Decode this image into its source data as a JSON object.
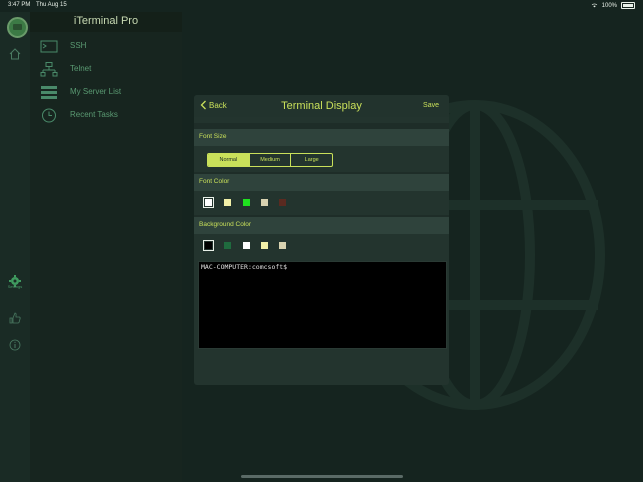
{
  "status_bar": {
    "time": "3:47 PM",
    "date": "Thu Aug 15",
    "battery": "100%"
  },
  "app": {
    "title": "iTerminal Pro"
  },
  "side_menu": {
    "items": [
      {
        "label": "SSH",
        "icon": "terminal-icon"
      },
      {
        "label": "Telnet",
        "icon": "network-icon"
      },
      {
        "label": "My Server List",
        "icon": "server-list-icon"
      },
      {
        "label": "Recent Tasks",
        "icon": "clock-icon"
      }
    ]
  },
  "rail": {
    "settings_label": "Settings"
  },
  "dialog": {
    "back_label": "Back",
    "title": "Terminal Display",
    "save_label": "Save",
    "font_size": {
      "header": "Font Size",
      "options": [
        "Normal",
        "Medium",
        "Large"
      ],
      "selected": "Normal"
    },
    "font_color": {
      "header": "Font Color",
      "swatches": [
        "#ffffff",
        "#f2f0a8",
        "#1fe11f",
        "#d8d2b0",
        "#5a2a20"
      ],
      "selected_index": 0
    },
    "background_color": {
      "header": "Background Color",
      "swatches": [
        "#000000",
        "#1f6b3e",
        "#ffffff",
        "#f2f0a8",
        "#d8d2b0"
      ],
      "selected_index": 0
    },
    "terminal_preview": {
      "prompt": "MAC-COMPUTER:comcsoft$"
    }
  },
  "colors": {
    "accent": "#c9e05a",
    "background": "#15241f",
    "menu_text": "#5a9a72"
  }
}
